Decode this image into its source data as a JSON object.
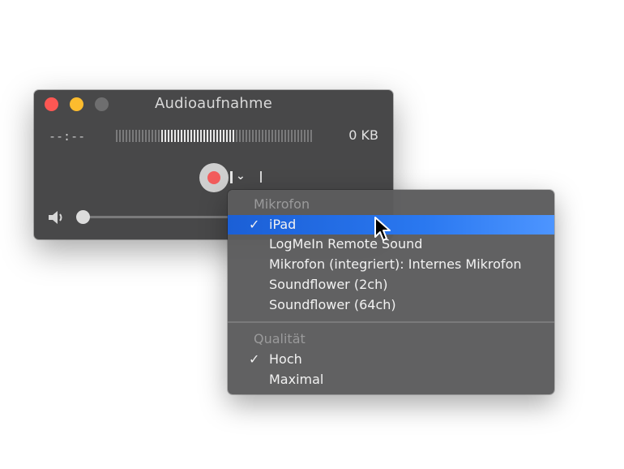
{
  "window": {
    "title": "Audioaufnahme",
    "timer": "--:--",
    "file_size": "0 KB",
    "level_meter_fraction": 0.48,
    "volume_fraction": 0.0
  },
  "menu": {
    "sections": [
      {
        "title": "Mikrofon",
        "items": [
          {
            "label": "iPad",
            "checked": true,
            "highlighted": true
          },
          {
            "label": "LogMeIn Remote Sound",
            "checked": false
          },
          {
            "label": "Mikrofon (integriert): Internes Mikrofon",
            "checked": false
          },
          {
            "label": "Soundflower (2ch)",
            "checked": false
          },
          {
            "label": "Soundflower (64ch)",
            "checked": false
          }
        ]
      },
      {
        "title": "Qualität",
        "items": [
          {
            "label": "Hoch",
            "checked": true
          },
          {
            "label": "Maximal",
            "checked": false
          }
        ]
      }
    ],
    "check_glyph": "✓"
  },
  "icons": {
    "close": "close-button-icon",
    "minimize": "minimize-button-icon",
    "zoom": "zoom-button-icon",
    "record": "record-icon",
    "options": "chevron-down-icon",
    "volume": "speaker-icon",
    "cursor": "mouse-pointer-icon"
  },
  "colors": {
    "highlight": "#2a78f0",
    "record": "#f25c5c",
    "close": "#fc5753",
    "minimize": "#fdbc2e"
  }
}
